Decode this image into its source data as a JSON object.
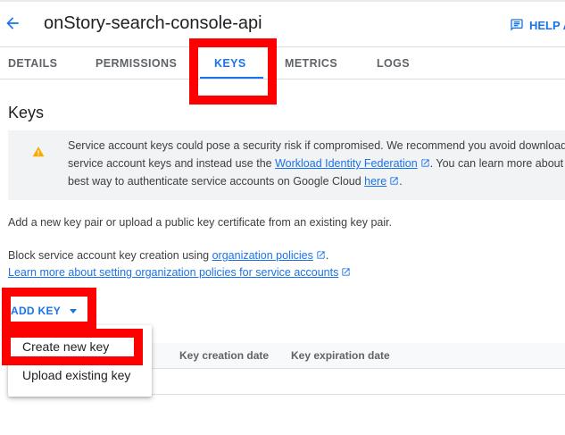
{
  "header": {
    "title": "onStory-search-console-api",
    "help_label": "HELP A"
  },
  "tabs": [
    {
      "label": "DETAILS"
    },
    {
      "label": "PERMISSIONS"
    },
    {
      "label": "KEYS",
      "active": true
    },
    {
      "label": "METRICS"
    },
    {
      "label": "LOGS"
    }
  ],
  "keys": {
    "title": "Keys",
    "warning": {
      "line1": "Service account keys could pose a security risk if compromised. We recommend you avoid downloading",
      "line2_pre": "service account keys and instead use the ",
      "line2_link": "Workload Identity Federation",
      "line2_post": ". You can learn more about the",
      "line3_pre": "best way to authenticate service accounts on Google Cloud ",
      "line3_link": "here",
      "line3_post": "."
    },
    "add_key_text": "Add a new key pair or upload a public key certificate from an existing key pair.",
    "block_text_pre": "Block service account key creation using ",
    "block_link": "organization policies",
    "block_text_post": ".",
    "learn_more_link": "Learn more about setting organization policies for service accounts",
    "add_key_button": "ADD KEY",
    "table_headers": {
      "creation": "Key creation date",
      "expiration": "Key expiration date"
    },
    "menu": {
      "create": "Create new key",
      "upload": "Upload existing key"
    }
  },
  "colors": {
    "accent": "#1a73e8",
    "warning": "#f9ab00",
    "highlight": "#ff0000"
  }
}
